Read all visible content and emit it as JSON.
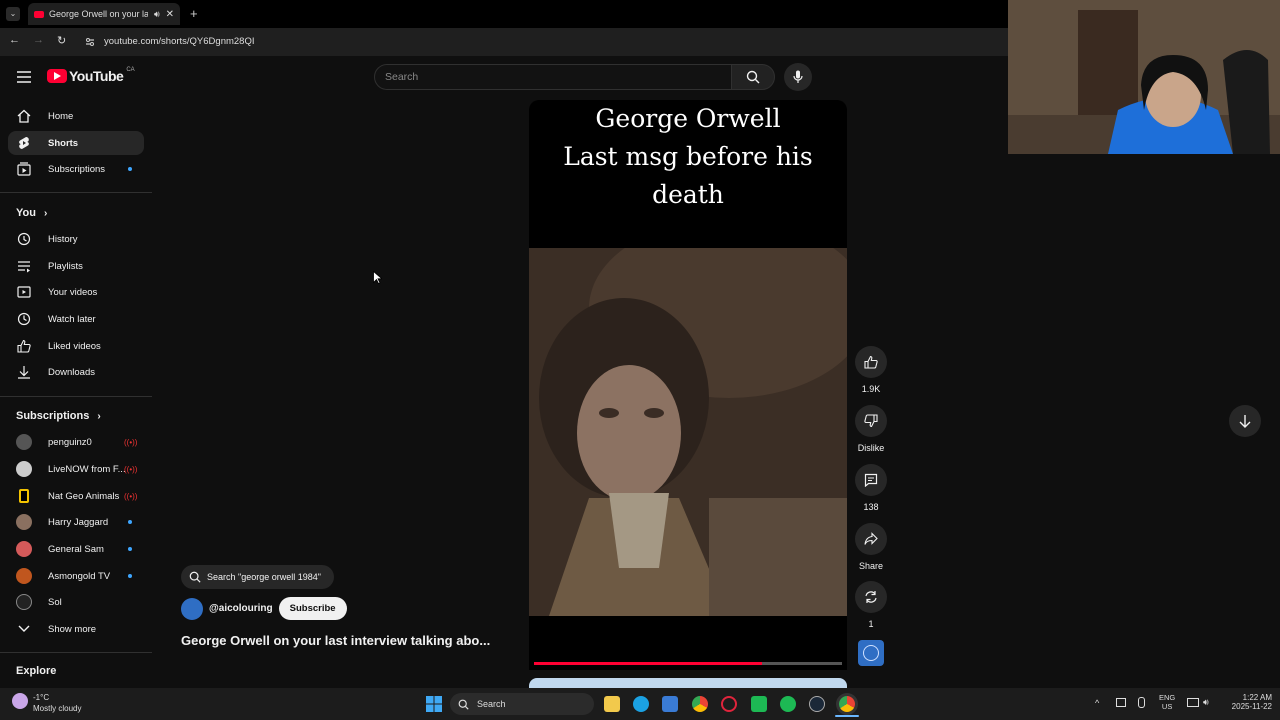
{
  "browser": {
    "tab_title": "George Orwell on your last",
    "url": "youtube.com/shorts/QY6Dgnm28QI"
  },
  "header": {
    "logo_text": "YouTube",
    "region": "CA",
    "search_placeholder": "Search"
  },
  "sidebar": {
    "items": [
      {
        "label": "Home",
        "icon": "home-icon"
      },
      {
        "label": "Shorts",
        "icon": "shorts-icon",
        "active": true
      },
      {
        "label": "Subscriptions",
        "icon": "subscriptions-icon"
      }
    ],
    "you_heading": "You",
    "you_items": [
      {
        "label": "History",
        "icon": "history-icon"
      },
      {
        "label": "Playlists",
        "icon": "playlists-icon"
      },
      {
        "label": "Your videos",
        "icon": "your-videos-icon"
      },
      {
        "label": "Watch later",
        "icon": "watch-later-icon"
      },
      {
        "label": "Liked videos",
        "icon": "liked-videos-icon"
      },
      {
        "label": "Downloads",
        "icon": "downloads-icon"
      }
    ],
    "subs_heading": "Subscriptions",
    "subs": [
      {
        "name": "penguinz0",
        "status": "live"
      },
      {
        "name": "LiveNOW from F...",
        "status": "live"
      },
      {
        "name": "Nat Geo Animals",
        "status": "live"
      },
      {
        "name": "Harry Jaggard",
        "status": "new"
      },
      {
        "name": "General Sam",
        "status": "new"
      },
      {
        "name": "Asmongold TV",
        "status": "new"
      },
      {
        "name": "Sol",
        "status": "none"
      }
    ],
    "show_more": "Show more",
    "explore_heading": "Explore"
  },
  "short": {
    "overlay_line1": "George Orwell",
    "overlay_line2": "Last msg before his death",
    "progress": 0.74,
    "search_suggestion": "Search \"george orwell 1984\"",
    "channel": "@aicolouring",
    "subscribe_label": "Subscribe",
    "title": "George Orwell on your last interview talking abo..."
  },
  "actions": {
    "like_count": "1.9K",
    "dislike_label": "Dislike",
    "comment_count": "138",
    "share_label": "Share",
    "remix_count": "1"
  },
  "taskbar": {
    "temperature": "-1°C",
    "weather": "Mostly cloudy",
    "search_label": "Search",
    "lang": "ENG",
    "region": "US",
    "time": "1:22 AM",
    "date": "2025-11-22"
  },
  "colors": {
    "accent_red": "#ff0033",
    "link_blue": "#3ea6ff",
    "bg": "#0f0f0f"
  }
}
